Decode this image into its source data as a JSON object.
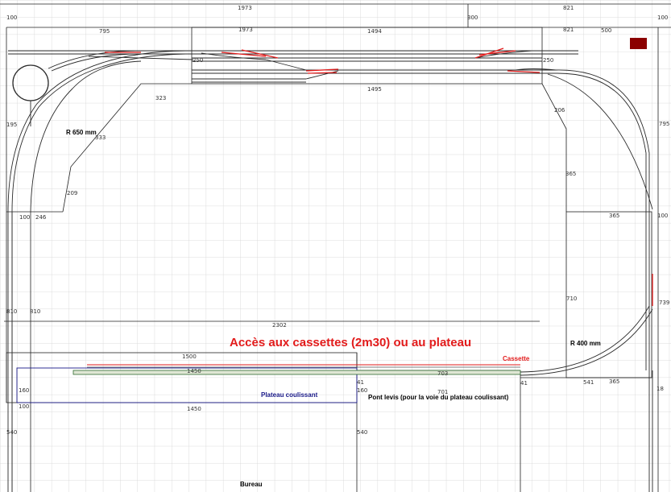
{
  "title": "Accès aux cassettes (2m30) ou au plateau",
  "labels": {
    "radius_650": "R 650 mm",
    "radius_400": "R 400 mm",
    "cassette": "Cassette",
    "plateau": "Plateau coulissant",
    "pont": "Pont levis (pour la voie du plateau coulissant)",
    "bureau": "Bureau"
  },
  "dims": {
    "d1973_top": "1973",
    "d821_top": "821",
    "d100_tl": "100",
    "d300": "300",
    "d100_tr": "100",
    "d795_l": "795",
    "d1973_in": "1973",
    "d1494": "1494",
    "d821_in": "821",
    "d500": "500",
    "d250_l": "250",
    "d250_r": "250",
    "d1495": "1495",
    "d323": "323",
    "d206": "206",
    "d195": "195",
    "d795_r": "795",
    "d333": "333",
    "d365_a": "365",
    "d209": "209",
    "d100_mid": "100",
    "d246": "246",
    "d365_b": "365",
    "d100_r2": "100",
    "d810_a": "810",
    "d810_b": "810",
    "d710": "710",
    "d739": "739",
    "d2302": "2302",
    "d1500": "1500",
    "d1450_a": "1450",
    "d703": "703",
    "d41_a": "41",
    "d41_b": "41",
    "d160_a": "160",
    "d160_b": "160",
    "d701": "701",
    "d541": "541",
    "d365_c": "365",
    "d100_bl": "100",
    "d1450_b": "1450",
    "d540_a": "540",
    "d540_b": "540",
    "d18": "18"
  },
  "colors": {
    "grid": "#d4d4d4",
    "track": "#2b2b2b",
    "turnout": "#e21b1b",
    "buffer": "#8b0000",
    "title": "#e21b1b",
    "plateau": "#1b1b8a"
  }
}
